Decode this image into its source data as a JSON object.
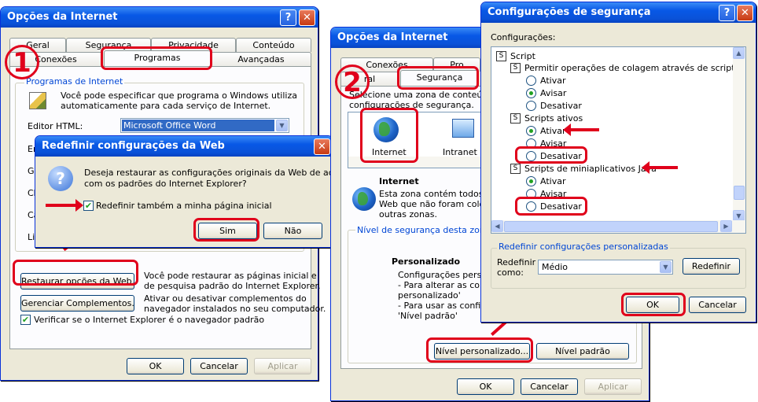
{
  "win1": {
    "title": "Opções da Internet",
    "tabs_row1": [
      "Geral",
      "Segurança",
      "Privacidade",
      "Conteúdo"
    ],
    "tabs_row2": [
      "Conexões",
      "Programas",
      "Avançadas"
    ],
    "group_title": "Programas de Internet",
    "group_desc_1": "Você pode especificar que programa o Windows utiliza",
    "group_desc_2": "automaticamente para cada serviço de Internet.",
    "html_editor_label": "Editor HTML:",
    "html_editor_value": "Microsoft Office Word",
    "partial_labels": [
      "Em",
      "Gru",
      "Ch",
      "Ca",
      "Lis"
    ],
    "reset_button": "Restaurar opções da Web...",
    "reset_desc_1": "Você pode restaurar as páginas inicial e",
    "reset_desc_2": "de pesquisa padrão do Internet Explorer.",
    "addons_button": "Gerenciar Complementos...",
    "addons_desc_1": "Ativar ou desativar complementos do",
    "addons_desc_2": "navegador instalados no seu computador.",
    "check_default": "Verificar se o Internet Explorer é o navegador padrão",
    "ok": "OK",
    "cancel": "Cancelar",
    "apply": "Aplicar",
    "step": "1"
  },
  "dialog": {
    "title": "Redefinir configurações da Web",
    "question_1": "Deseja restaurar as configurações originais da Web de acordo",
    "question_2": "com os padrões do Internet Explorer?",
    "checkbox": "Redefinir também a minha página inicial",
    "yes": "Sim",
    "no": "Não"
  },
  "win2": {
    "title": "Opções da Internet",
    "tab_connections": "Conexões",
    "tab_partial": "Pro",
    "tab_general": "ral",
    "tab_security": "Segurança",
    "select_zone_1": "Selecione uma zona de conteúdo da",
    "select_zone_2": "configurações de segurança.",
    "zone_internet": "Internet",
    "zone_intranet": "Intranet lo",
    "zone_title": "Internet",
    "zone_desc_1": "Esta zona contém todos os",
    "zone_desc_2": "Web que não foram colocad",
    "zone_desc_3": "outras zonas.",
    "level_group": "Nível de segurança desta zona",
    "custom_title": "Personalizado",
    "custom_1": "Configurações persona",
    "custom_2": "- Para alterar as config",
    "custom_3": "personalizado'",
    "custom_4": "- Para usar as configu",
    "custom_5": "'Nível padrão'",
    "custom_level_button": "Nível personalizado...",
    "default_level_button": "Nível padrão",
    "ok": "OK",
    "cancel": "Cancelar",
    "apply": "Aplicar",
    "step": "2"
  },
  "sec": {
    "title": "Configurações de segurança",
    "settings_label": "Configurações:",
    "tree": {
      "script": "Script",
      "paste": "Permitir operações de colagem através de script",
      "paste_opts": [
        "Ativar",
        "Avisar",
        "Desativar"
      ],
      "active": "Scripts ativos",
      "active_opts": [
        "Ativar",
        "Avisar",
        "Desativar"
      ],
      "java": "Scripts de miniaplicativos Java",
      "java_opts": [
        "Ativar",
        "Avisar",
        "Desativar"
      ]
    },
    "reset_group": "Redefinir configurações personalizadas",
    "reset_to_1": "Redefinir",
    "reset_to_2": "como:",
    "reset_value": "Médio",
    "reset_button": "Redefinir",
    "ok": "OK",
    "cancel": "Cancelar"
  },
  "colors": {
    "accent_red": "#e0001b",
    "title_blue": "#0a52d8",
    "group_blue": "#0046d5"
  }
}
